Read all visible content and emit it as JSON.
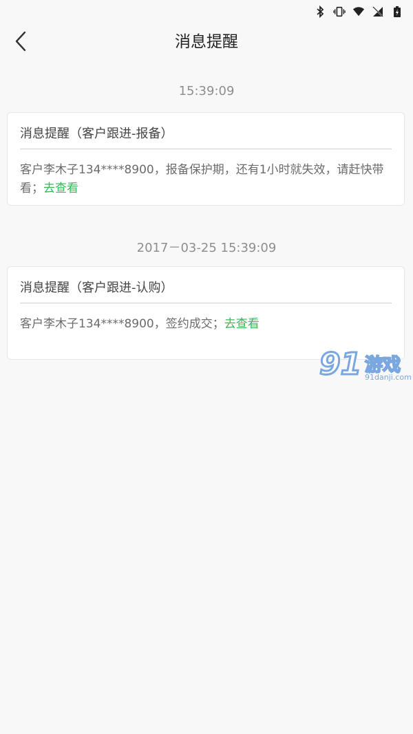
{
  "status_bar": {
    "icons": [
      "bluetooth-icon",
      "vibrate-icon",
      "wifi-icon",
      "no-signal-icon",
      "battery-charging-icon"
    ]
  },
  "header": {
    "title": "消息提醒"
  },
  "messages": [
    {
      "time": "15:39:09",
      "title": "消息提醒（客户跟进-报备）",
      "body": "客户李木子134****8900，报备保护期，还有1小时就失效，请赶快带看；",
      "link": "去查看"
    },
    {
      "time": "2017－03-25 15:39:09",
      "title": "消息提醒（客户跟进-认购）",
      "body": "客户李木子134****8900，签约成交；",
      "link": "去查看"
    }
  ],
  "watermark": {
    "number": "91",
    "name": "游戏",
    "site": "91danji.com"
  },
  "colors": {
    "link": "#3cb55a",
    "background": "#f8f8f8",
    "card": "#ffffff"
  }
}
